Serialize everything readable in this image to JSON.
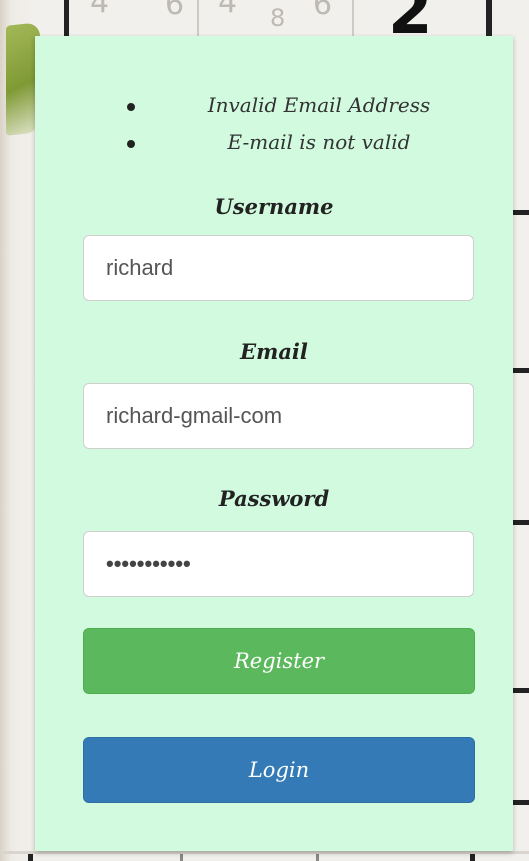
{
  "errors": [
    "Invalid Email Address",
    "E-mail is not valid"
  ],
  "form": {
    "username_label": "Username",
    "username_value": "richard",
    "email_label": "Email",
    "email_value": "richard-gmail-com",
    "password_label": "Password",
    "password_value": "richard1234",
    "register_label": "Register",
    "login_label": "Login"
  },
  "colors": {
    "panel_background": "#d1fadf",
    "register_button": "#5cb85c",
    "login_button": "#337ab7"
  },
  "icons": {
    "list_bullet": "bullet-icon"
  }
}
